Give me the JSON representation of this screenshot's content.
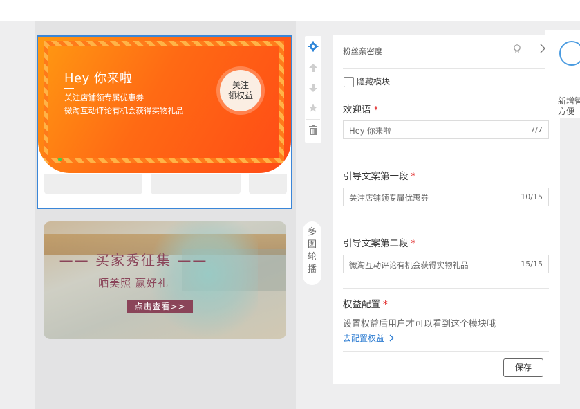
{
  "welcome_module": {
    "greeting": "Hey 你来啦",
    "guide_line_1": "关注店铺领专属优惠券",
    "guide_line_2": "微淘互动评论有机会获得实物礼品",
    "follow_button": [
      "关注",
      "领权益"
    ]
  },
  "buyer_show": {
    "title": "—— 买家秀征集 ——",
    "subtitle": "晒美照   赢好礼",
    "cta": "点击查看>>"
  },
  "toolbar": {
    "icons": [
      "gear-icon",
      "arrow-up-icon",
      "arrow-down-icon",
      "star-icon",
      "trash-icon"
    ]
  },
  "carousel_tag": [
    "多",
    "图",
    "轮",
    "播"
  ],
  "panel": {
    "header": "粉丝亲密度",
    "hide_module_label": "隐藏模块",
    "fields": [
      {
        "label": "欢迎语",
        "value": "Hey 你来啦",
        "count": "7/7"
      },
      {
        "label": "引导文案第一段",
        "value": "关注店铺领专属优惠券",
        "count": "10/15"
      },
      {
        "label": "引导文案第二段",
        "value": "微淘互动评论有机会获得实物礼品",
        "count": "15/15"
      }
    ],
    "benefit_label": "权益配置",
    "benefit_desc": "设置权益后用户才可以看到这个模块哦",
    "config_link": "去配置权益",
    "save_button": "保存"
  },
  "tip_panel": {
    "text": [
      "新增智",
      "方便"
    ]
  },
  "colors": {
    "accent_blue": "#3a86d8",
    "banner_orange": "#ff6a14",
    "required_red": "#e02020",
    "link_blue": "#2b7bd1"
  }
}
